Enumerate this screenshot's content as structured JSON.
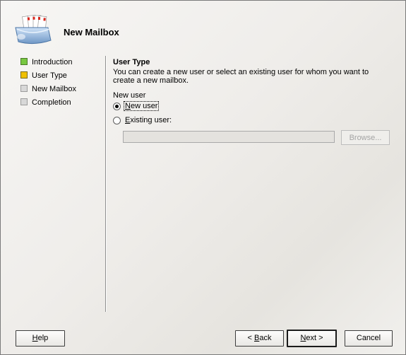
{
  "window": {
    "title": "New Mailbox",
    "icon": "mailbox-icon"
  },
  "steps": [
    {
      "label": "Introduction",
      "status": "completed",
      "color": "#78c840"
    },
    {
      "label": "User Type",
      "status": "current",
      "color": "#f0c000"
    },
    {
      "label": "New Mailbox",
      "status": "pending",
      "color": "#d8d8d8"
    },
    {
      "label": "Completion",
      "status": "pending",
      "color": "#d8d8d8"
    }
  ],
  "page": {
    "title": "User Type",
    "description": "You can create a new user or select an existing user for whom you want to create a new mailbox.",
    "group_label": "New user",
    "options": [
      {
        "label": "New user",
        "mnemonic": "N",
        "checked": true
      },
      {
        "label": "Existing user:",
        "mnemonic": "E",
        "checked": false
      }
    ],
    "existing_user_value": "",
    "browse_label": "Browse..."
  },
  "buttons": {
    "help": "Help",
    "back": "< Back",
    "next": "Next >",
    "cancel": "Cancel"
  }
}
